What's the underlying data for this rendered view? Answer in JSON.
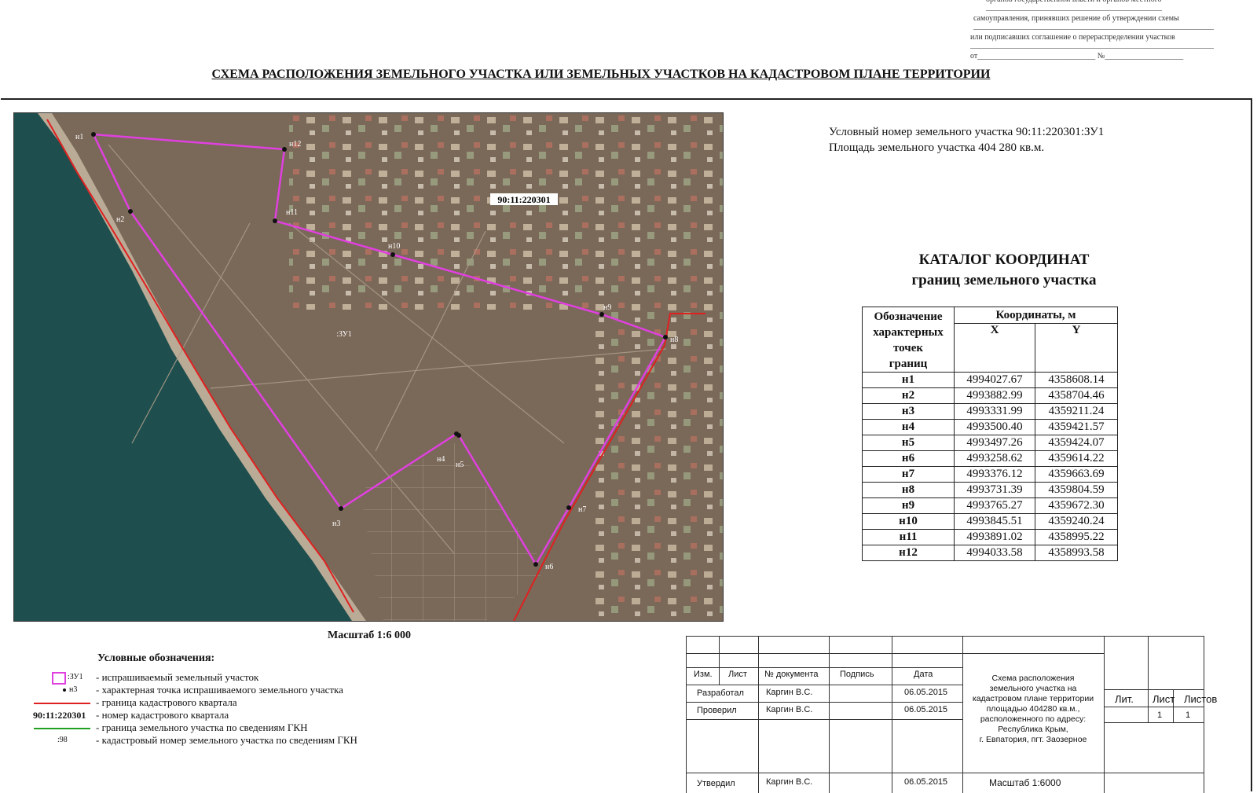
{
  "header": {
    "approval_lines": [
      "органов государственной власти и органов местного",
      "самоуправления, принявших решение об утверждении схемы",
      "или подписавших соглашение о перераспределении участков",
      "от______________________________ №____________________"
    ],
    "title": "СХЕМА РАСПОЛОЖЕНИЯ ЗЕМЕЛЬНОГО УЧАСТКА ИЛИ ЗЕМЕЛЬНЫХ УЧАСТКОВ НА КАДАСТРОВОМ ПЛАНЕ ТЕРРИТОРИИ"
  },
  "plot_info": {
    "line1": "Условный номер земельного участка 90:11:220301:ЗУ1",
    "line2": "Площадь земельного участка 404 280 кв.м."
  },
  "map": {
    "quarter_label": "90:11:220301",
    "plot_label": ":ЗУ1",
    "points": [
      "н1",
      "н2",
      "н3",
      "н4",
      "н5",
      "н6",
      "н7",
      "н8",
      "н9",
      "н10",
      "н11",
      "н12"
    ],
    "colors": {
      "plot": "#e040e0",
      "quarter": "#e02020",
      "gkn": "#20a020",
      "sea": "#1e4f4e",
      "land": "#7a6858"
    }
  },
  "scale_label": "Масштаб 1:6 000",
  "catalog": {
    "title_line1": "КАТАЛОГ КООРДИНАТ",
    "title_line2": "границ земельного участка",
    "header_designation": [
      "Обозначение",
      "характерных",
      "точек",
      "границ"
    ],
    "header_coords": "Координаты, м",
    "header_x": "X",
    "header_y": "Y",
    "rows": [
      {
        "name": "н1",
        "x": "4994027.67",
        "y": "4358608.14"
      },
      {
        "name": "н2",
        "x": "4993882.99",
        "y": "4358704.46"
      },
      {
        "name": "н3",
        "x": "4993331.99",
        "y": "4359211.24"
      },
      {
        "name": "н4",
        "x": "4993500.40",
        "y": "4359421.57"
      },
      {
        "name": "н5",
        "x": "4993497.26",
        "y": "4359424.07"
      },
      {
        "name": "н6",
        "x": "4993258.62",
        "y": "4359614.22"
      },
      {
        "name": "н7",
        "x": "4993376.12",
        "y": "4359663.69"
      },
      {
        "name": "н8",
        "x": "4993731.39",
        "y": "4359804.59"
      },
      {
        "name": "н9",
        "x": "4993765.27",
        "y": "4359672.30"
      },
      {
        "name": "н10",
        "x": "4993845.51",
        "y": "4359240.24"
      },
      {
        "name": "н11",
        "x": "4993891.02",
        "y": "4358995.22"
      },
      {
        "name": "н12",
        "x": "4994033.58",
        "y": "4358993.58"
      }
    ]
  },
  "legend": {
    "title": "Условные обозначения:",
    "items": [
      {
        "symbol": ":ЗУ1",
        "text": "- испрашиваемый земельный участок"
      },
      {
        "symbol": "н3",
        "text": "- характерная точка испрашиваемого земельного участка"
      },
      {
        "symbol": "",
        "text": "- граница кадастрового квартала"
      },
      {
        "symbol": "90:11:220301",
        "text": "- номер кадастрового квартала"
      },
      {
        "symbol": "",
        "text": "- граница  земельного участка по сведениям ГКН"
      },
      {
        "symbol": ":98",
        "text": "- кадастровый номер земельного участка по сведениям ГКН"
      }
    ]
  },
  "stamp": {
    "izm": "Изм.",
    "list": "Лист",
    "doc": "№ документа",
    "sign": "Подпись",
    "date": "Дата",
    "developed": "Разработал",
    "checked": "Проверил",
    "approved": "Утвердил",
    "person": "Каргин В.С.",
    "date_val": "06.05.2015",
    "description": [
      "Схема расположения",
      "земельного участка на",
      "кадастровом плане территории",
      "площадью 404280 кв.м.,",
      "расположенного по адресу:",
      "Республика Крым,",
      "г. Евпатория, пгт. Заозерное"
    ],
    "lit": "Лит.",
    "sheet": "Лист",
    "sheets": "Листов",
    "sheet_val": "1",
    "sheets_val": "1",
    "scale": "Масштаб 1:6000"
  }
}
